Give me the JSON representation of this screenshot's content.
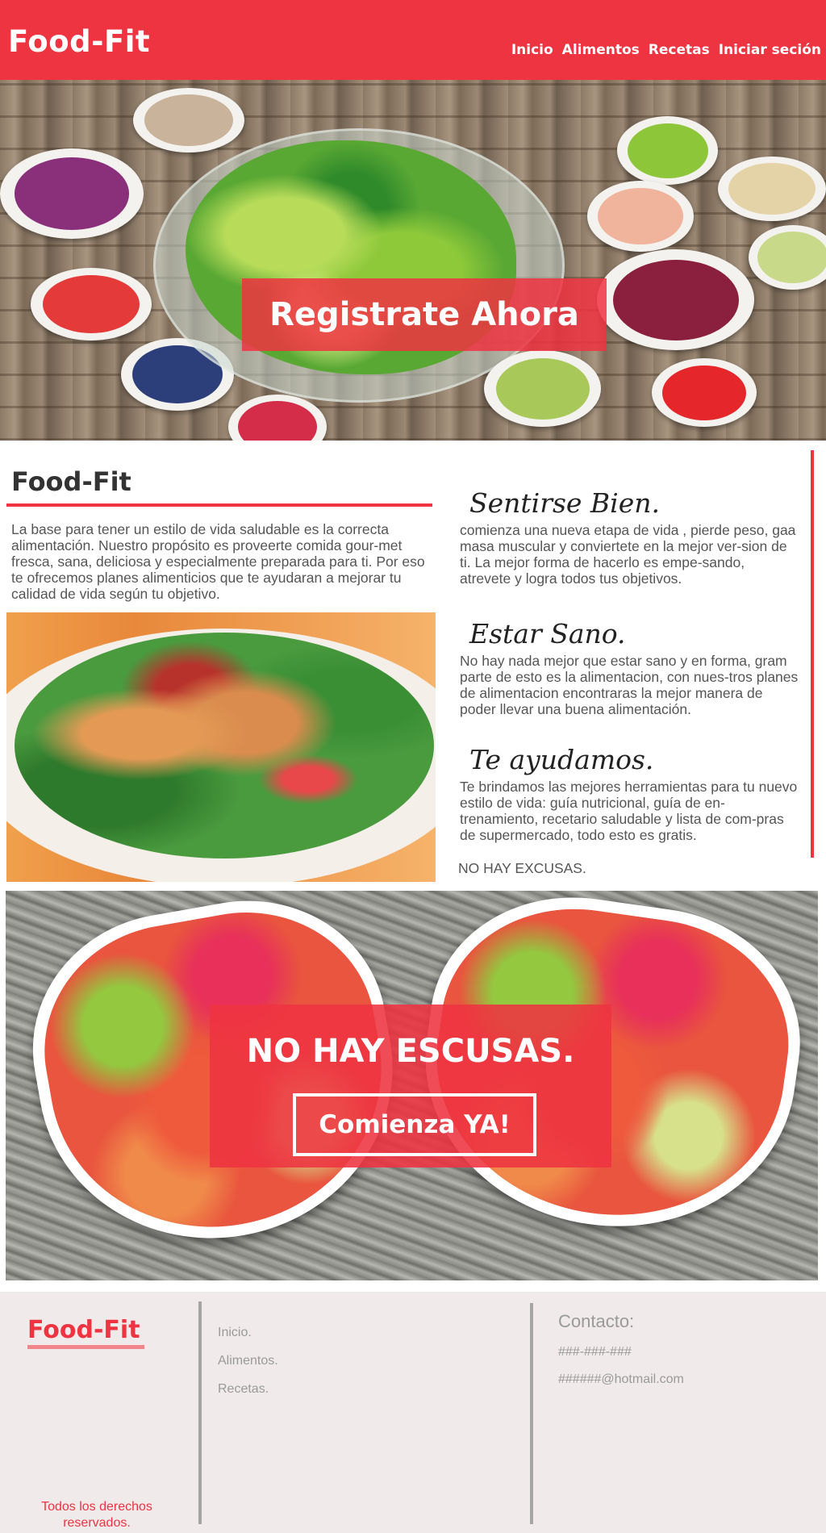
{
  "header": {
    "brand": "Food-Fit",
    "nav": [
      "Inicio",
      "Alimentos",
      "Recetas",
      "Iniciar seción"
    ]
  },
  "hero": {
    "cta_label": "Registrate Ahora"
  },
  "about": {
    "title": "Food-Fit",
    "text": "La base para tener un estilo de vida saludable es la correcta alimentación. Nuestro propósito es proveerte comida gour-met fresca, sana, deliciosa y especialmente preparada para ti. Por eso te ofrecemos planes alimenticios que te ayudaran a mejorar tu calidad de vida según tu objetivo."
  },
  "features": [
    {
      "heading": "Sentirse Bien.",
      "text": "comienza una nueva etapa de vida , pierde peso, gaa masa muscular y conviertete en la mejor ver-sion de ti. La mejor forma de hacerlo es empe-sando, atrevete y logra todos tus objetivos."
    },
    {
      "heading": "Estar Sano.",
      "text": "No hay nada mejor que estar sano y en forma, gram parte de esto es la alimentacion, con nues-tros planes de alimentacion encontraras la mejor manera de poder llevar una buena alimentación."
    },
    {
      "heading": "Te ayudamos.",
      "text": "Te brindamos las mejores herramientas para tu nuevo estilo de vida: guía nutricional, guía de en-trenamiento, recetario saludable y lista de com-pras de supermercado, todo esto es gratis."
    }
  ],
  "no_excuses_small": "NO HAY EXCUSAS.",
  "banner": {
    "title": "NO HAY ESCUSAS.",
    "button_label": "Comienza YA!"
  },
  "footer": {
    "brand": "Food-Fit",
    "rights": "Todos los derechos reservados.",
    "links": [
      "Inicio.",
      "Alimentos.",
      "Recetas."
    ],
    "contact_title": "Contacto:",
    "phone": "###-###-###",
    "email": "######@hotmail.com"
  },
  "colors": {
    "accent": "#ee3341",
    "footer_bg": "#f0eaea",
    "footer_text": "#9a9a9a"
  }
}
